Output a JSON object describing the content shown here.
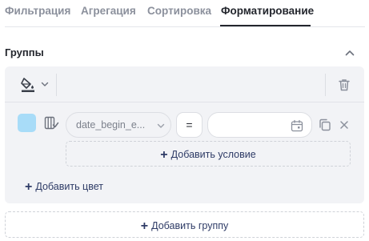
{
  "tabs": [
    {
      "label": "Фильтрация"
    },
    {
      "label": "Агрегация"
    },
    {
      "label": "Сортировка"
    },
    {
      "label": "Форматирование"
    }
  ],
  "active_tab": "Форматирование",
  "section": {
    "title": "Группы"
  },
  "group": {
    "color": "#a8dcf8",
    "condition": {
      "field_value": "date_begin_e...",
      "operator": "=",
      "date_value": ""
    },
    "add_condition_label": "Добавить условие",
    "add_color_label": "Добавить цвет"
  },
  "add_group_label": "Добавить группу",
  "icons": {
    "collapse": "chevron-up-icon",
    "fill": "paint-bucket-icon",
    "delete": "trash-icon",
    "column": "column-check-icon",
    "dropdown": "chevron-down-icon",
    "calendar": "calendar-icon",
    "copy": "copy-icon",
    "close": "close-icon",
    "add": "plus-icon"
  }
}
